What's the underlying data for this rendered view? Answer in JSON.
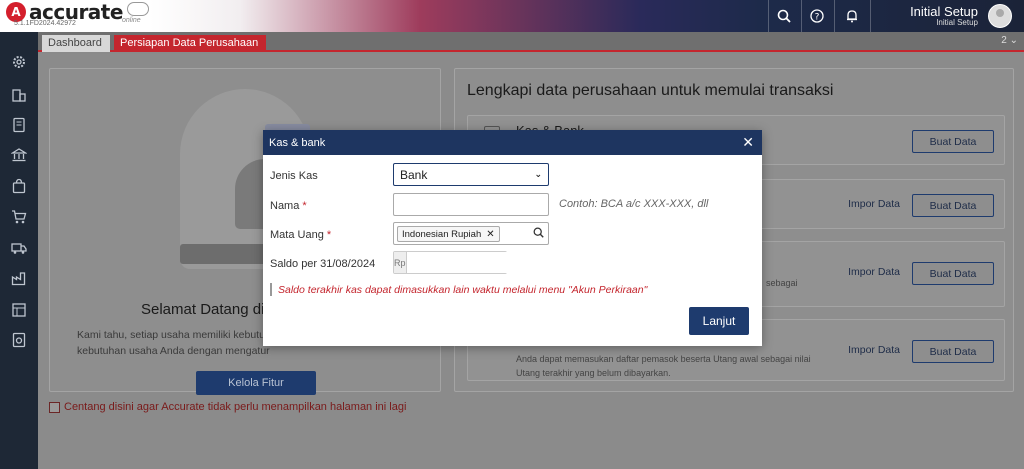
{
  "app": {
    "name": "accurate",
    "version": "5.1.1FD2024.42972",
    "edition": "online"
  },
  "topbar": {
    "user_name": "Initial Setup",
    "user_sub": "Initial Setup",
    "icons": [
      "search-icon",
      "help-icon",
      "bell-icon"
    ]
  },
  "sidebar": {
    "icons": [
      "gear-icon",
      "building-icon",
      "ledger-icon",
      "bank-icon",
      "bag-icon",
      "cart-icon",
      "truck-icon",
      "factory-icon",
      "report-icon",
      "settings-doc-icon"
    ]
  },
  "tabs": [
    {
      "label": "Dashboard"
    },
    {
      "label": "Persiapan Data Perusahaan"
    }
  ],
  "tab_count": "2 ⌄",
  "welcome": {
    "title": "Selamat Datang di A",
    "desc_line1": "Kami tahu, setiap usaha memiliki kebutuh",
    "desc_line2": "kebutuhan usaha Anda dengan mengatur",
    "button": "Kelola Fitur"
  },
  "checkbox_label": "Centang disini agar Accurate tidak perlu menampilkan halaman ini lagi",
  "right_panel": {
    "title": "Lengkapi data perusahaan untuk memulai transaksi",
    "options": [
      {
        "title": "Kas & Bank",
        "impor": "",
        "button": "Buat Data",
        "text1": "",
        "text2": ""
      },
      {
        "title": "",
        "impor": "Impor Data",
        "button": "Buat Data",
        "text1": "",
        "text2": ""
      },
      {
        "title": "",
        "impor": "Impor Data",
        "button": "Buat Data",
        "text1": "sebagai",
        "text2": ""
      },
      {
        "title": "",
        "impor": "Impor Data",
        "button": "Buat Data",
        "text1": "Anda dapat memasukan daftar pemasok beserta Utang awal sebagai nilai",
        "text2": "Utang terakhir yang belum dibayarkan."
      }
    ]
  },
  "modal": {
    "title": "Kas & bank",
    "close": "✕",
    "jenis_label": "Jenis Kas",
    "jenis_value": "Bank",
    "nama_label": "Nama",
    "nama_hint": "Contoh: BCA a/c XXX-XXX, dll",
    "mata_uang_label": "Mata Uang",
    "mata_uang_value": "Indonesian Rupiah",
    "saldo_label": "Saldo per 31/08/2024",
    "saldo_prefix": "Rp",
    "note": "Saldo terakhir kas dapat dimasukkan lain waktu melalui menu \"Akun Perkiraan\"",
    "button": "Lanjut"
  }
}
